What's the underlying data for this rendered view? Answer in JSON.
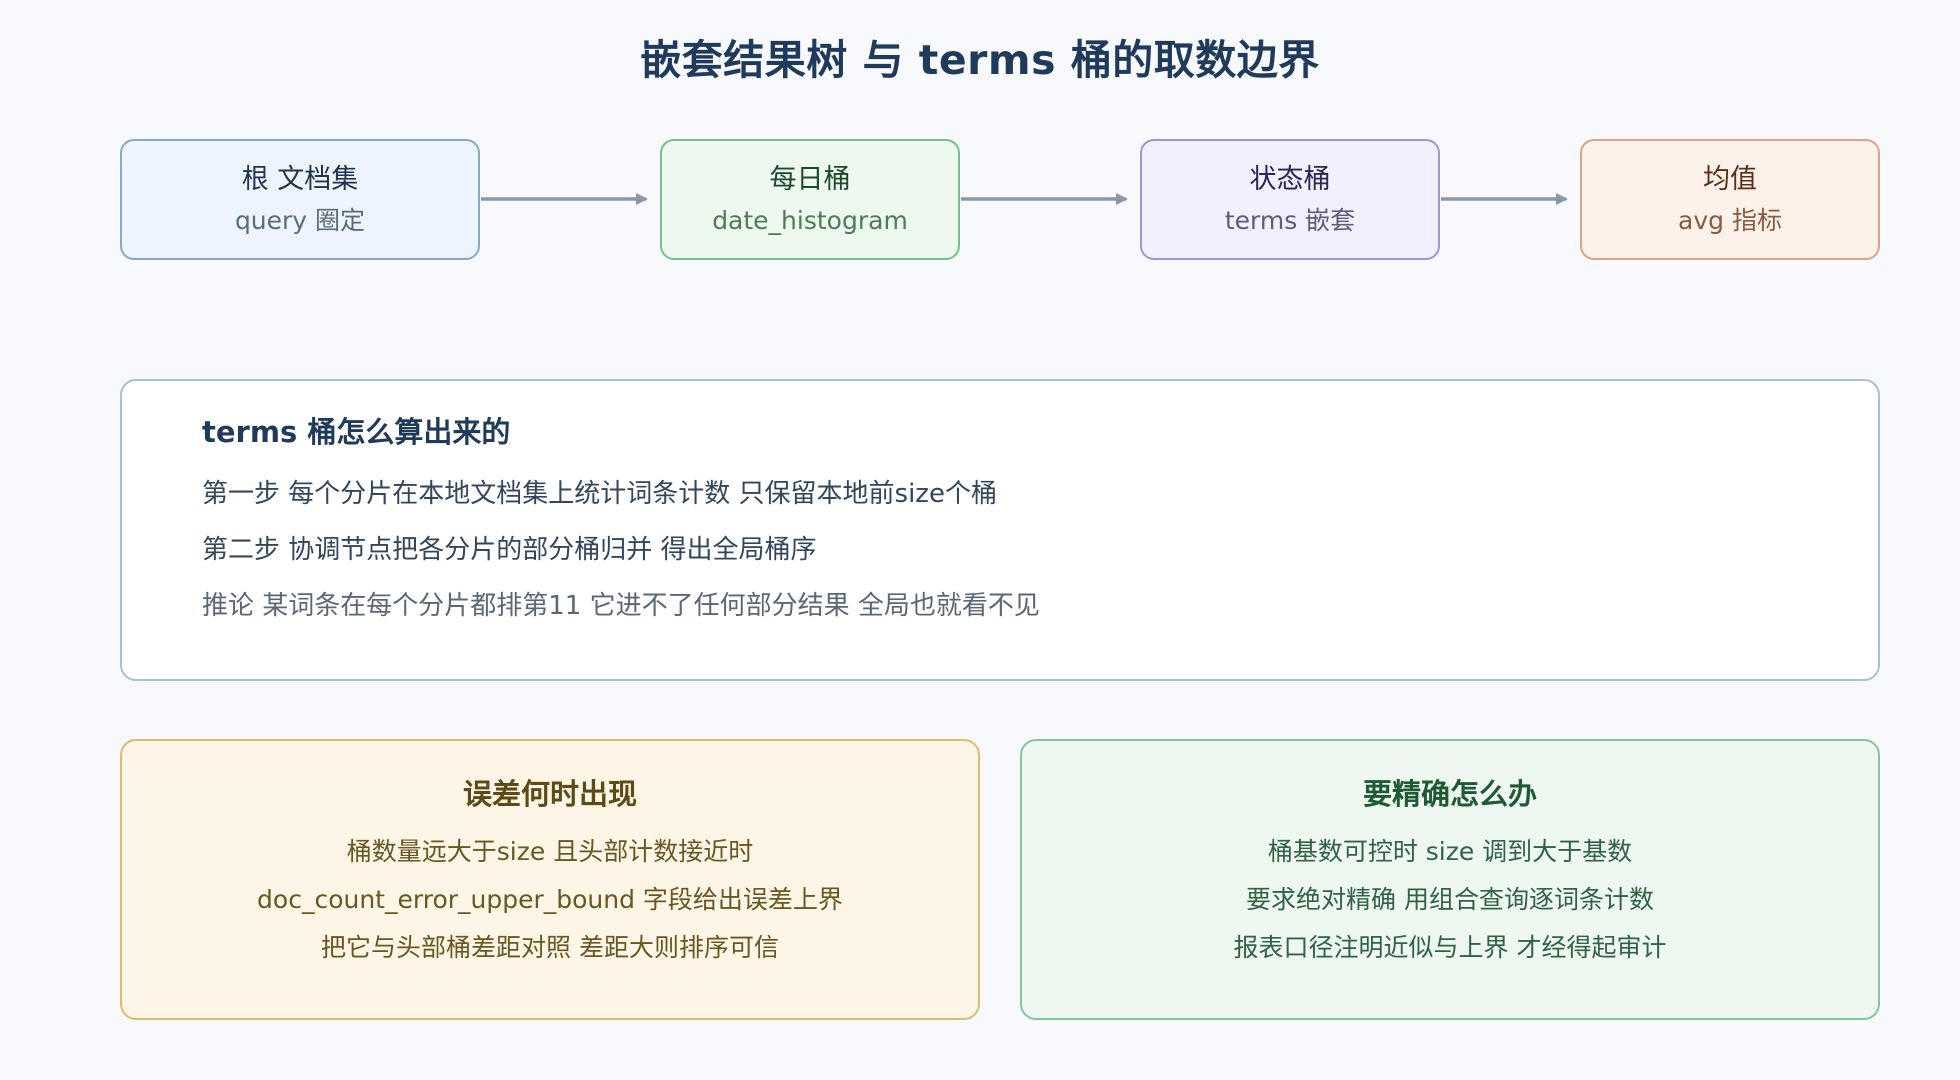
{
  "title": "嵌套结果树 与 terms 桶的取数边界",
  "flow": [
    {
      "name": "根 文档集",
      "sub": "query 圈定"
    },
    {
      "name": "每日桶",
      "sub": "date_histogram"
    },
    {
      "name": "状态桶",
      "sub": "terms 嵌套"
    },
    {
      "name": "均值",
      "sub": "avg 指标"
    }
  ],
  "steps_panel": {
    "title": "terms 桶怎么算出来的",
    "lines": [
      "第一步 每个分片在本地文档集上统计词条计数 只保留本地前size个桶",
      "第二步 协调节点把各分片的部分桶归并 得出全局桶序",
      "推论 某词条在每个分片都排第11 它进不了任何部分结果 全局也就看不见"
    ]
  },
  "cards": [
    {
      "title": "误差何时出现",
      "lines": [
        "桶数量远大于size 且头部计数接近时",
        "doc_count_error_upper_bound 字段给出误差上界",
        "把它与头部桶差距对照 差距大则排序可信"
      ]
    },
    {
      "title": "要精确怎么办",
      "lines": [
        "桶基数可控时 size 调到大于基数",
        "要求绝对精确 用组合查询逐词条计数",
        "报表口径注明近似与上界 才经得起审计"
      ]
    }
  ],
  "colors": {
    "arrow": "#8a97ab",
    "title": "#1f3a5b"
  }
}
